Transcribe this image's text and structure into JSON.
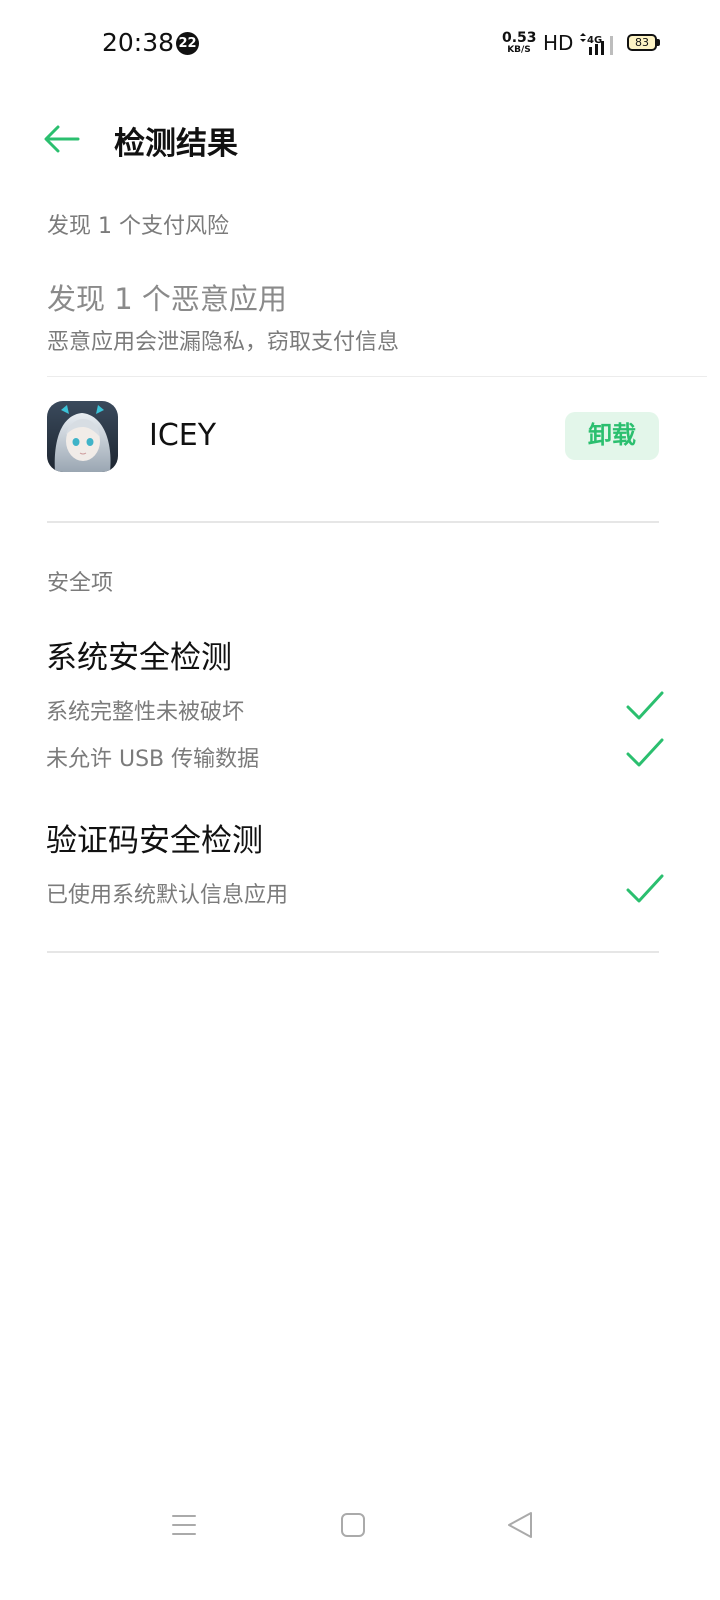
{
  "status_bar": {
    "time": "20:38",
    "notification_count": "22",
    "net_speed": "0.53",
    "net_speed_unit": "KB/S",
    "hd": "HD",
    "network": "4G",
    "battery": "83"
  },
  "header": {
    "title": "检测结果",
    "back_icon": "arrow-left-icon"
  },
  "payment_risk": {
    "summary": "发现 1 个支付风险",
    "malicious_title": "发现 1 个恶意应用",
    "malicious_desc": "恶意应用会泄漏隐私，窃取支付信息",
    "app": {
      "name": "ICEY",
      "action_label": "卸载"
    }
  },
  "security": {
    "header": "安全项",
    "groups": [
      {
        "title": "系统安全检测",
        "items": [
          {
            "label": "系统完整性未被破坏",
            "status": "passed"
          },
          {
            "label": "未允许 USB 传输数据",
            "status": "passed"
          }
        ]
      },
      {
        "title": "验证码安全检测",
        "items": [
          {
            "label": "已使用系统默认信息应用",
            "status": "passed"
          }
        ]
      }
    ]
  },
  "nav_bar": {
    "items": [
      "menu-icon",
      "home-icon",
      "back-triangle-icon"
    ]
  },
  "colors": {
    "accent": "#2bbf6f",
    "accent_bg": "#e3f6ea",
    "muted_text": "#7b7b7b"
  }
}
